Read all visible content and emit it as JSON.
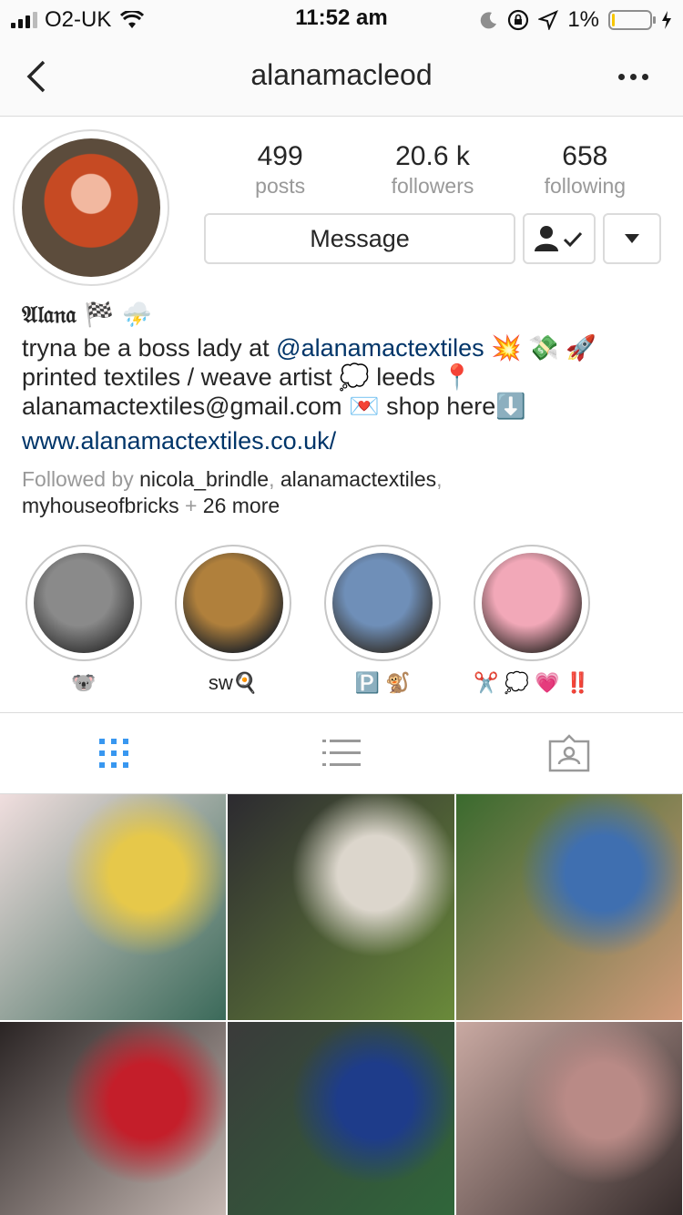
{
  "status": {
    "carrier": "O2-UK",
    "time": "11:52 am",
    "battery_pct": "1%",
    "battery_level": 0.01
  },
  "nav": {
    "title": "alanamacleod"
  },
  "stats": [
    {
      "num": "499",
      "label": "posts"
    },
    {
      "num": "20.6 k",
      "label": "followers"
    },
    {
      "num": "658",
      "label": "following"
    }
  ],
  "buttons": {
    "message": "Message"
  },
  "bio": {
    "name": "𝔄𝔩𝔞𝔫𝔞 🏁 ⛈️",
    "line1_pre": "tryna be a boss lady at ",
    "line1_mention": "@alanamactextiles",
    "line1_post": " 💥 💸 🚀",
    "line2": "printed textiles / weave artist 💭 leeds 📍",
    "line3": "alanamactextiles@gmail.com 💌 shop here⬇️",
    "link": "www.alanamactextiles.co.uk/"
  },
  "followed_by": {
    "prefix": "Followed by ",
    "user1": "nicola_brindle",
    "sep1": ", ",
    "user2": "alanamactextiles",
    "sep2": ",",
    "user3": "myhouseofbricks",
    "plus": " + ",
    "more": "26 more"
  },
  "highlights": [
    {
      "label": "🐨",
      "colors": [
        "#8a8a8a",
        "#3c3c3c"
      ]
    },
    {
      "label": "sw🍳",
      "colors": [
        "#b0803c",
        "#2a2a2a"
      ]
    },
    {
      "label": "🅿️ 🐒",
      "colors": [
        "#6f8fb8",
        "#3a3a3a"
      ]
    },
    {
      "label": "✂️ 💭 💗 ‼️",
      "colors": [
        "#f2a8b8",
        "#4a3a3a"
      ]
    }
  ],
  "tabs": [
    "grid-view",
    "list-view",
    "tagged-view"
  ],
  "posts": [
    {
      "colors": [
        "#f0dede",
        "#3b6a5a",
        "#e6c84a"
      ]
    },
    {
      "colors": [
        "#2c2a30",
        "#6a8a3a",
        "#dcd6cc"
      ]
    },
    {
      "colors": [
        "#3a6a2e",
        "#d09a7a",
        "#3f6fb0"
      ]
    },
    {
      "colors": [
        "#2a2424",
        "#d2c4be",
        "#c41e2a"
      ]
    },
    {
      "colors": [
        "#3a3a3a",
        "#2f6a3a",
        "#1e3c8a"
      ]
    },
    {
      "colors": [
        "#c9a9a2",
        "#2a2222",
        "#b98a86"
      ]
    }
  ]
}
